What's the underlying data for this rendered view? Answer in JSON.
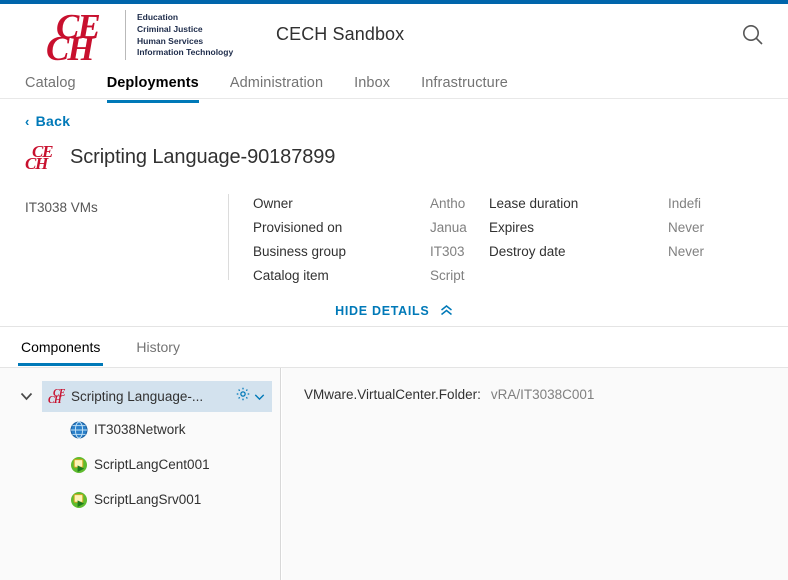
{
  "brand": {
    "logo_top": "CE",
    "logo_bottom": "CH",
    "lines": [
      "Education",
      "Criminal Justice",
      "Human Services",
      "Information Technology"
    ],
    "accent_red": "#c8102e"
  },
  "header": {
    "app_title": "CECH Sandbox",
    "search_icon": "search-icon",
    "accent_blue": "#0065ab"
  },
  "nav": {
    "tabs": [
      {
        "label": "Catalog",
        "active": false
      },
      {
        "label": "Deployments",
        "active": true
      },
      {
        "label": "Administration",
        "active": false
      },
      {
        "label": "Inbox",
        "active": false
      },
      {
        "label": "Infrastructure",
        "active": false
      }
    ]
  },
  "back": {
    "label": "Back",
    "chevron": "‹",
    "icon": "chevron-left-icon"
  },
  "page": {
    "title": "Scripting Language-90187899",
    "logo_top": "CE",
    "logo_bottom": "CH"
  },
  "details": {
    "group_name": "IT3038 VMs",
    "column1": [
      {
        "label": "Owner",
        "value": "Antho"
      },
      {
        "label": "Provisioned on",
        "value": "Janua"
      },
      {
        "label": "Business group",
        "value": "IT303"
      },
      {
        "label": "Catalog item",
        "value": "Script"
      }
    ],
    "column2": [
      {
        "label": "Lease duration",
        "value": "Indefi"
      },
      {
        "label": "Expires",
        "value": "Never"
      },
      {
        "label": "Destroy date",
        "value": "Never"
      }
    ],
    "hide_details_label": "HIDE DETAILS",
    "hide_details_chevron": "⌃",
    "hide_details_icon": "double-chevron-up-icon"
  },
  "subnav": {
    "tabs": [
      {
        "label": "Components",
        "active": true
      },
      {
        "label": "History",
        "active": false
      }
    ]
  },
  "tree": {
    "root": {
      "label": "Scripting Language-...",
      "caret": "⌄",
      "caret_icon": "chevron-down-icon",
      "gear_icon": "gear-icon",
      "menu_icon": "chevron-down-icon",
      "selected": true
    },
    "children": [
      {
        "label": "IT3038Network",
        "icon": "network-globe-icon",
        "type": "network"
      },
      {
        "label": "ScriptLangCent001",
        "icon": "virtual-machine-icon",
        "type": "vm"
      },
      {
        "label": "ScriptLangSrv001",
        "icon": "virtual-machine-icon",
        "type": "vm"
      }
    ]
  },
  "properties": [
    {
      "key": "VMware.VirtualCenter.Folder:",
      "value": "vRA/IT3038C001"
    }
  ]
}
